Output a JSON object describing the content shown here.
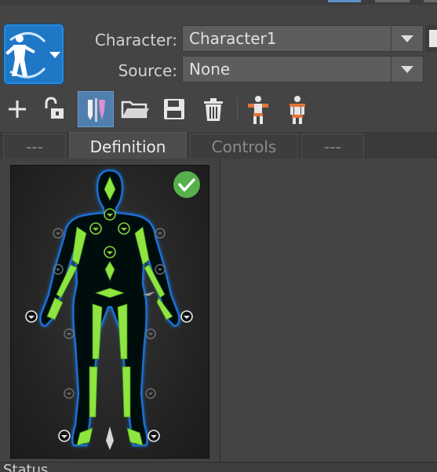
{
  "header": {
    "character_label": "Character:",
    "character_value": "Character1",
    "source_label": "Source:",
    "source_value": "None"
  },
  "toolbar": {
    "icons": [
      "plus-icon",
      "lock-open-icon",
      "pencil-stick-icon",
      "folder-icon",
      "save-icon",
      "trash-icon",
      "skeleton-icon",
      "skeleton-biped-icon"
    ],
    "active": "pencil-stick-icon"
  },
  "tabs": [
    {
      "label": "---",
      "active": false
    },
    {
      "label": "Definition",
      "active": true
    },
    {
      "label": "Controls",
      "active": false
    },
    {
      "label": "---",
      "active": false
    }
  ],
  "status": {
    "label": "Status"
  },
  "colors": {
    "accent": "#4f7fae",
    "bone_green": "#8ee53f",
    "body_outline": "#1a6fd1",
    "valid_check": "#56b04c"
  },
  "definition": {
    "valid_icon": "check-circle-icon"
  }
}
